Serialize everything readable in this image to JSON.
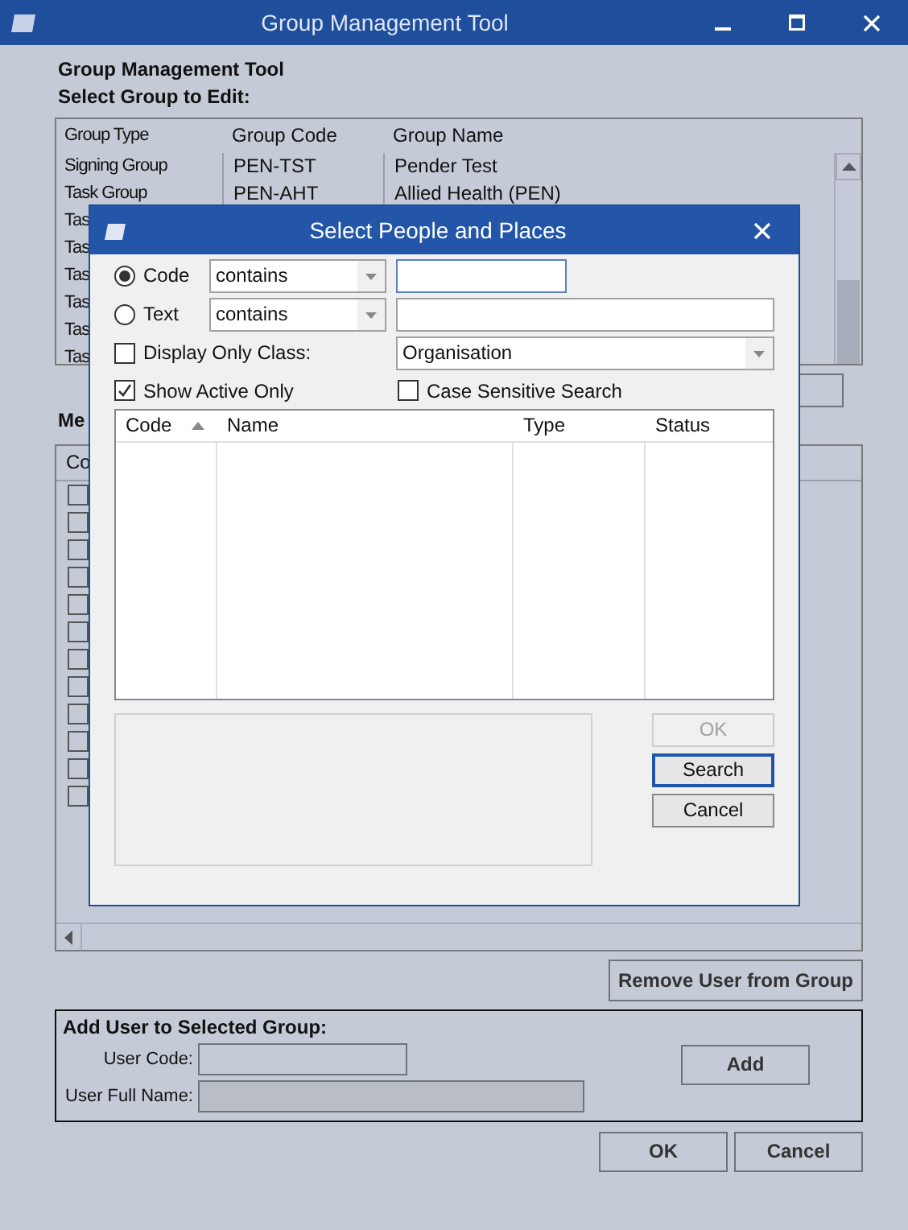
{
  "window": {
    "title": "Group Management Tool"
  },
  "heading": "Group Management Tool",
  "select_label": "Select Group to Edit:",
  "groups_table": {
    "columns": [
      "Group Type",
      "Group Code",
      "Group Name"
    ],
    "rows": [
      {
        "type": "Signing Group",
        "code": "PEN-TST",
        "name": "Pender Test"
      },
      {
        "type": "Task Group",
        "code": "PEN-AHT",
        "name": "Allied Health (PEN)"
      },
      {
        "type": "Tas"
      },
      {
        "type": "Tas"
      },
      {
        "type": "Tas"
      },
      {
        "type": "Tas"
      },
      {
        "type": "Tas"
      },
      {
        "type": "Tas"
      }
    ]
  },
  "members_label": "Me",
  "members_table": {
    "columns": [
      "Co"
    ],
    "rows": [
      {
        "checked": false
      },
      {
        "checked": false
      },
      {
        "checked": false
      },
      {
        "checked": false
      },
      {
        "checked": false
      },
      {
        "checked": false
      },
      {
        "checked": false
      },
      {
        "checked": false
      },
      {
        "checked": false
      },
      {
        "checked": false
      },
      {
        "checked": false
      },
      {
        "checked": false
      }
    ]
  },
  "remove_button": "Remove User from Group",
  "add_user": {
    "title": "Add User to Selected Group:",
    "fields": [
      {
        "label": "User Code:",
        "disabled": false
      },
      {
        "label": "User Full Name:",
        "disabled": true
      }
    ],
    "button": "Add"
  },
  "buttons": [
    "OK",
    "Cancel"
  ],
  "dialog": {
    "title": "Select People and Places",
    "search_modes": [
      {
        "label": "Code",
        "selected": true,
        "operator": "contains",
        "focused": true
      },
      {
        "label": "Text",
        "selected": false,
        "operator": "contains",
        "focused": false
      }
    ],
    "options": [
      {
        "label": "Display Only Class:",
        "checked": false
      },
      {
        "label": "Show Active Only",
        "checked": true
      },
      {
        "label": "Case Sensitive Search",
        "checked": false
      }
    ],
    "class_value": "Organisation",
    "results_columns": [
      {
        "label": "Code",
        "sorted": true
      },
      {
        "label": "Name",
        "sorted": false
      },
      {
        "label": "Type",
        "sorted": false
      },
      {
        "label": "Status",
        "sorted": false
      }
    ],
    "buttons": [
      {
        "label": "OK",
        "disabled": true,
        "default": false
      },
      {
        "label": "Search",
        "disabled": false,
        "default": true
      },
      {
        "label": "Cancel",
        "disabled": false,
        "default": false
      }
    ]
  }
}
